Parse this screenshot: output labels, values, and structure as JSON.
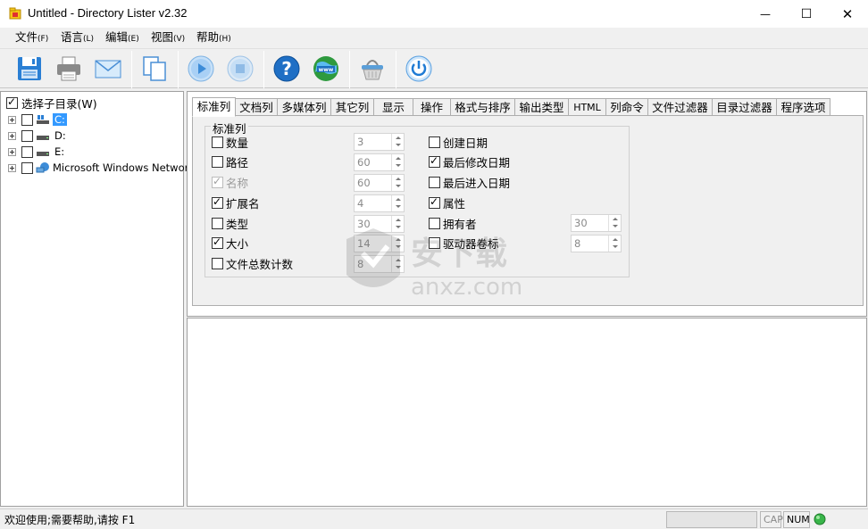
{
  "window": {
    "title": "Untitled - Directory Lister v2.32",
    "minimize_glyph": "—",
    "maximize_glyph": "☐",
    "close_glyph": "✕"
  },
  "menu": [
    {
      "label": "文件",
      "accel": "(F)"
    },
    {
      "label": "语言",
      "accel": "(L)"
    },
    {
      "label": "编辑",
      "accel": "(E)"
    },
    {
      "label": "视图",
      "accel": "(V)"
    },
    {
      "label": "帮助",
      "accel": "(H)"
    }
  ],
  "toolbar": {
    "icons": [
      "save-icon",
      "print-icon",
      "email-icon",
      "copy-icon",
      "play-icon",
      "stop-icon",
      "help-icon",
      "web-icon",
      "basket-icon",
      "power-icon"
    ]
  },
  "tree": {
    "header_label": "选择子目录(W)",
    "header_checked": true,
    "items": [
      {
        "label": "C:",
        "icon": "drive-c-icon",
        "selected": true
      },
      {
        "label": "D:",
        "icon": "drive-icon",
        "selected": false
      },
      {
        "label": "E:",
        "icon": "drive-icon",
        "selected": false
      },
      {
        "label": "Microsoft Windows Network",
        "icon": "network-icon",
        "selected": false
      }
    ]
  },
  "tabs": [
    "标准列",
    "文档列",
    "多媒体列",
    "其它列",
    "显示",
    "操作",
    "格式与排序",
    "输出类型",
    "HTML",
    "列命令",
    "文件过滤器",
    "目录过滤器",
    "程序选项"
  ],
  "active_tab": 0,
  "standard_columns": {
    "group_label": "标准列",
    "left": [
      {
        "label": "数量",
        "checked": false,
        "disabled": false,
        "value": "3"
      },
      {
        "label": "路径",
        "checked": false,
        "disabled": false,
        "value": "60"
      },
      {
        "label": "名称",
        "checked": true,
        "disabled": true,
        "value": "60"
      },
      {
        "label": "扩展名",
        "checked": true,
        "disabled": false,
        "value": "4"
      },
      {
        "label": "类型",
        "checked": false,
        "disabled": false,
        "value": "30"
      },
      {
        "label": "大小",
        "checked": true,
        "disabled": false,
        "value": "14"
      },
      {
        "label": "文件总数计数",
        "checked": false,
        "disabled": false,
        "value": "8"
      }
    ],
    "right": [
      {
        "label": "创建日期",
        "checked": false
      },
      {
        "label": "最后修改日期",
        "checked": true
      },
      {
        "label": "最后进入日期",
        "checked": false
      },
      {
        "label": "属性",
        "checked": true
      },
      {
        "label": "拥有者",
        "checked": false,
        "value": "30"
      },
      {
        "label": "驱动器卷标",
        "checked": false,
        "value": "8"
      }
    ]
  },
  "watermark": {
    "line1": "安下载",
    "line2": "anxz.com"
  },
  "status": {
    "text": "欢迎使用;需要帮助,请按 F1",
    "cap": "CAP",
    "num": "NUM"
  }
}
